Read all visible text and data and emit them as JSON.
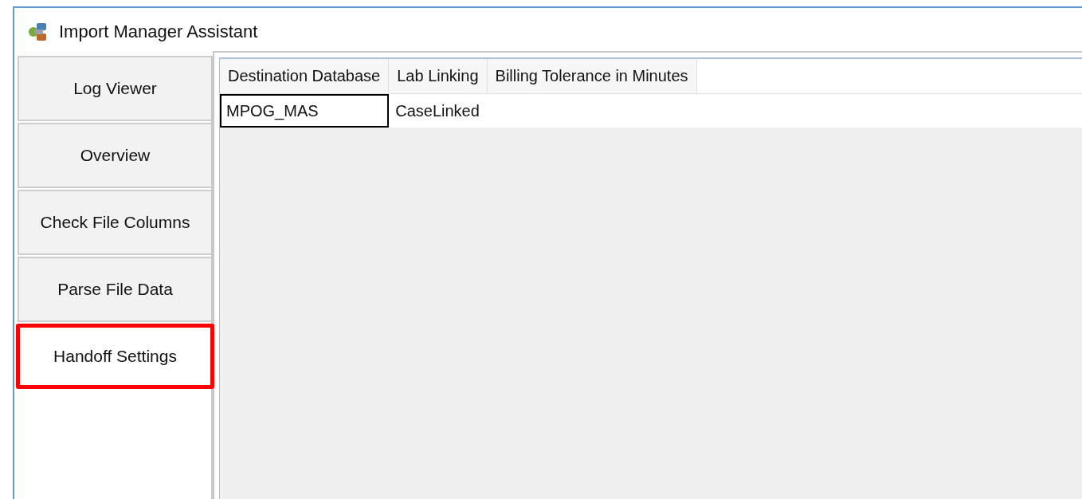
{
  "window": {
    "title": "Import Manager Assistant"
  },
  "tabs": [
    {
      "label": "Log Viewer",
      "selected": false,
      "highlighted": false
    },
    {
      "label": "Overview",
      "selected": false,
      "highlighted": false
    },
    {
      "label": "Check File Columns",
      "selected": false,
      "highlighted": false
    },
    {
      "label": "Parse File Data",
      "selected": false,
      "highlighted": false
    },
    {
      "label": "Handoff Settings",
      "selected": true,
      "highlighted": true
    }
  ],
  "table": {
    "columns": [
      "Destination Database",
      "Lab Linking",
      "Billing Tolerance in Minutes"
    ],
    "rows": [
      {
        "cells": [
          {
            "text": "MPOG_MAS",
            "focused": true
          },
          {
            "text": "CaseLinked",
            "focused": false
          }
        ]
      }
    ]
  }
}
